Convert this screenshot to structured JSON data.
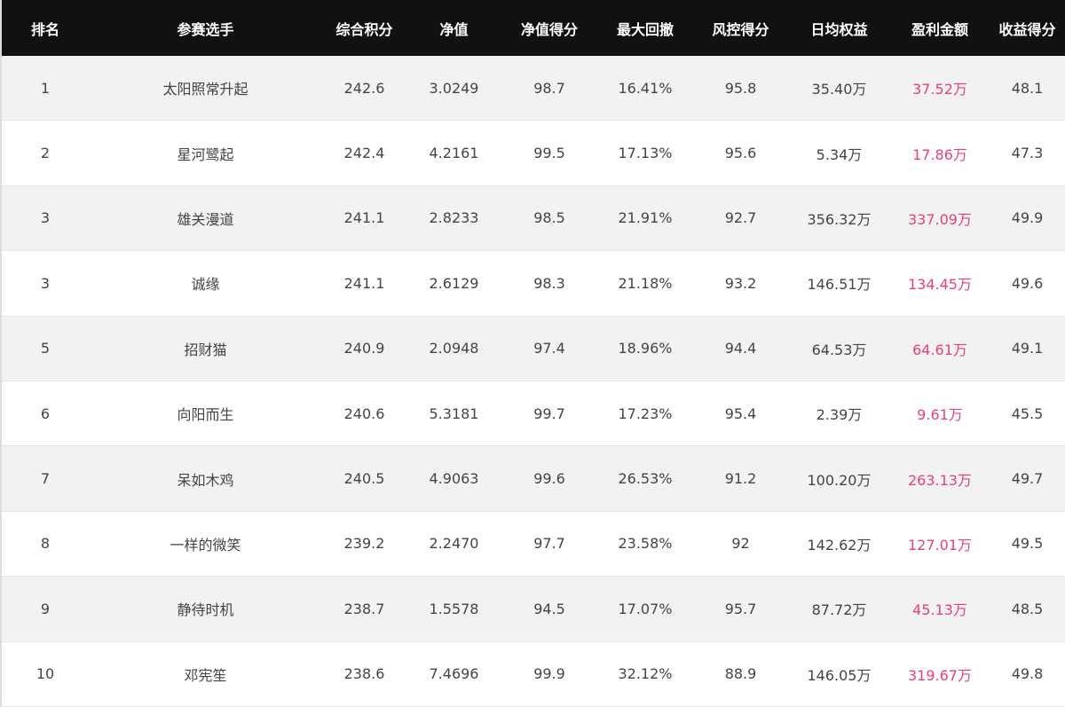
{
  "table": {
    "headers": [
      "排名",
      "参赛选手",
      "综合积分",
      "净值",
      "净值得分",
      "最大回撤",
      "风控得分",
      "日均权益",
      "盈利金额",
      "收益得分"
    ],
    "rows": [
      [
        "1",
        "太阳照常升起",
        "242.6",
        "3.0249",
        "98.7",
        "16.41%",
        "95.8",
        "35.40万",
        "37.52万",
        "48.1"
      ],
      [
        "2",
        "星河鹭起",
        "242.4",
        "4.2161",
        "99.5",
        "17.13%",
        "95.6",
        "5.34万",
        "17.86万",
        "47.3"
      ],
      [
        "3",
        "雄关漫道",
        "241.1",
        "2.8233",
        "98.5",
        "21.91%",
        "92.7",
        "356.32万",
        "337.09万",
        "49.9"
      ],
      [
        "3",
        "诚缘",
        "241.1",
        "2.6129",
        "98.3",
        "21.18%",
        "93.2",
        "146.51万",
        "134.45万",
        "49.6"
      ],
      [
        "5",
        "招财猫",
        "240.9",
        "2.0948",
        "97.4",
        "18.96%",
        "94.4",
        "64.53万",
        "64.61万",
        "49.1"
      ],
      [
        "6",
        "向阳而生",
        "240.6",
        "5.3181",
        "99.7",
        "17.23%",
        "95.4",
        "2.39万",
        "9.61万",
        "45.5"
      ],
      [
        "7",
        "呆如木鸡",
        "240.5",
        "4.9063",
        "99.6",
        "26.53%",
        "91.2",
        "100.20万",
        "263.13万",
        "49.7"
      ],
      [
        "8",
        "一样的微笑",
        "239.2",
        "2.2470",
        "97.7",
        "23.58%",
        "92",
        "142.62万",
        "127.01万",
        "49.5"
      ],
      [
        "9",
        "静待时机",
        "238.7",
        "1.5578",
        "94.5",
        "17.07%",
        "95.7",
        "87.72万",
        "45.13万",
        "48.5"
      ],
      [
        "10",
        "邓宪笙",
        "238.6",
        "7.4696",
        "99.9",
        "32.12%",
        "88.9",
        "146.05万",
        "319.67万",
        "49.8"
      ]
    ]
  },
  "colors": {
    "header_bg": "#111111",
    "header_text": "#ffffff",
    "row_alt_bg": "#f2f2f2",
    "profit_text": "#e8407e",
    "body_text": "#444444"
  }
}
